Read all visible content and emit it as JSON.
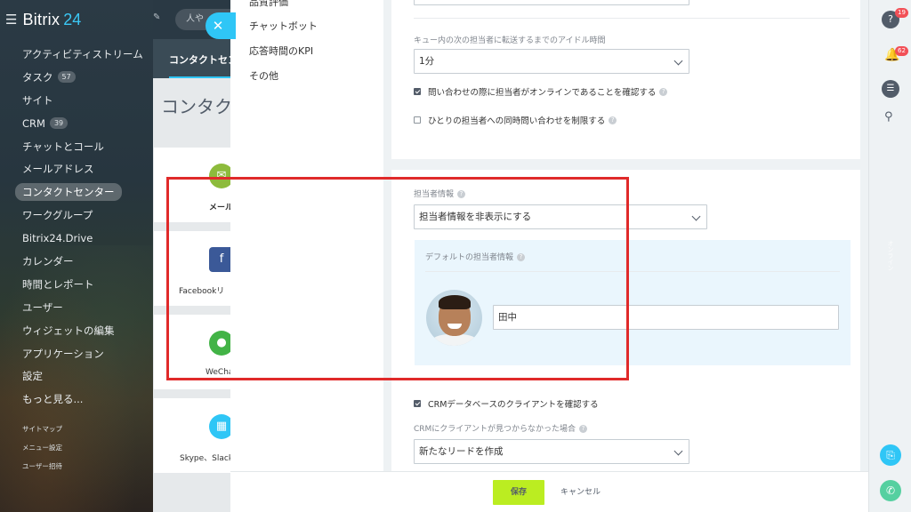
{
  "sidebar": {
    "logo": "Bitrix",
    "logo_num": "24",
    "items": [
      {
        "label": "アクティビティストリーム"
      },
      {
        "label": "タスク",
        "count": "57"
      },
      {
        "label": "サイト"
      },
      {
        "label": "CRM",
        "count": "39"
      },
      {
        "label": "チャットとコール"
      },
      {
        "label": "メールアドレス"
      },
      {
        "label": "コンタクトセンター",
        "active": true
      },
      {
        "label": "ワークグループ"
      },
      {
        "label": "Bitrix24.Drive"
      },
      {
        "label": "カレンダー"
      },
      {
        "label": "時間とレポート"
      },
      {
        "label": "ユーザー"
      },
      {
        "label": "ウィジェットの編集"
      },
      {
        "label": "アプリケーション"
      },
      {
        "label": "設定"
      },
      {
        "label": "もっと見る..."
      }
    ],
    "small_items": [
      "サイトマップ",
      "メニュー設定",
      "ユーザー招待"
    ]
  },
  "mid": {
    "search_placeholder": "人や",
    "tab": "コンタクトセン",
    "title": "コンタクト",
    "tiles": [
      {
        "label": "メール",
        "icon": "mail-icon",
        "color": "#8dbb3c"
      },
      {
        "label": "Facebookリ",
        "icon": "facebook-icon",
        "color": "#3b5998"
      },
      {
        "label": "WeCha",
        "icon": "wechat-icon",
        "color": "#42b346"
      },
      {
        "label": "Skype、Slack",
        "icon": "apps-icon",
        "color": "#2fc6f6"
      }
    ]
  },
  "slider": {
    "nav": [
      "品質評価",
      "チャットボット",
      "応答時間のKPI",
      "その他"
    ],
    "card1": {
      "idle_label": "キュー内の次の担当者に転送するまでのアイドル時間",
      "idle_value": "1分",
      "check1": "問い合わせの際に担当者がオンラインであることを確認する",
      "check1_on": true,
      "check2": "ひとりの担当者への同時問い合わせを制限する",
      "check2_on": false
    },
    "card2": {
      "agent_info_label": "担当者情報",
      "agent_info_value": "担当者情報を非表示にする",
      "default_label": "デフォルトの担当者情報",
      "default_name": "田中",
      "crm_check": "CRMデータベースのクライアントを確認する",
      "crm_check_on": true,
      "crm_notfound_label": "CRMにクライアントが見つからなかった場合",
      "crm_notfound_value": "新たなリードを作成"
    },
    "footer": {
      "save": "保存",
      "cancel": "キャンセル"
    }
  },
  "rightbar": {
    "help_badge": "19",
    "notif_badge": "62",
    "side_text": "オンライン"
  },
  "colors": {
    "accent": "#2fc6f6",
    "save": "#bbed21",
    "highlight": "#e02a2a",
    "badge": "#f25057"
  }
}
